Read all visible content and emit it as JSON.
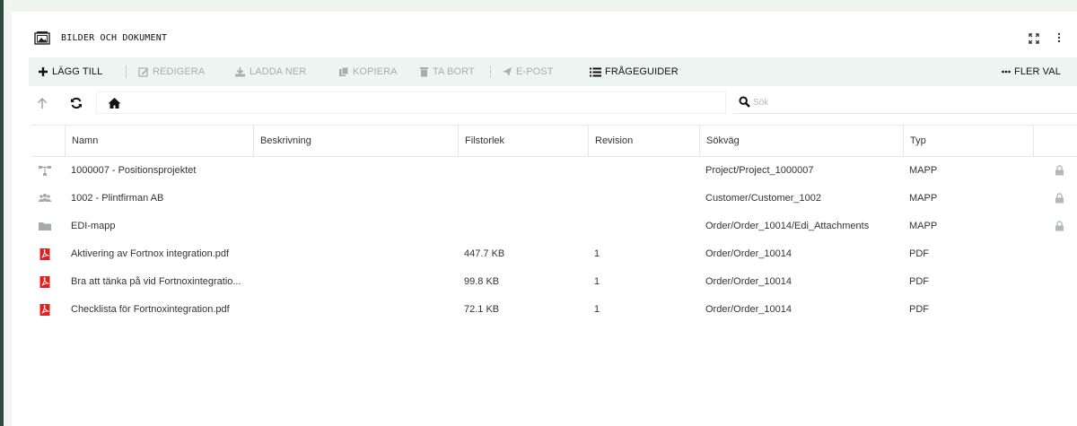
{
  "panel": {
    "title": "BILDER OCH DOKUMENT"
  },
  "toolbar": {
    "add": "LÄGG TILL",
    "edit": "REDIGERA",
    "download": "LADDA NER",
    "copy": "KOPIERA",
    "delete": "TA BORT",
    "email": "E-POST",
    "query_guides": "FRÅGEGUIDER",
    "more": "FLER VAL"
  },
  "search": {
    "placeholder": "Sök"
  },
  "table": {
    "columns": [
      "Namn",
      "Beskrivning",
      "Filstorlek",
      "Revision",
      "Sökväg",
      "Typ"
    ],
    "rows": [
      {
        "icon": "project-tree-icon",
        "name": "1000007 - Positionsprojektet",
        "description": "",
        "size": "",
        "revision": "",
        "path": "Project/Project_1000007",
        "type": "MAPP",
        "locked": true
      },
      {
        "icon": "customer-group-icon",
        "name": "1002 - Plintfirman AB",
        "description": "",
        "size": "",
        "revision": "",
        "path": "Customer/Customer_1002",
        "type": "MAPP",
        "locked": true
      },
      {
        "icon": "folder-icon",
        "name": "EDI-mapp",
        "description": "",
        "size": "",
        "revision": "",
        "path": "Order/Order_10014/Edi_Attachments",
        "type": "MAPP",
        "locked": true
      },
      {
        "icon": "pdf-icon",
        "name": "Aktivering av Fortnox integration.pdf",
        "description": "",
        "size": "447.7 KB",
        "revision": "1",
        "path": "Order/Order_10014",
        "type": "PDF",
        "locked": false
      },
      {
        "icon": "pdf-icon",
        "name": "Bra att tänka på vid Fortnoxintegratio...",
        "description": "",
        "size": "99.8 KB",
        "revision": "1",
        "path": "Order/Order_10014",
        "type": "PDF",
        "locked": false
      },
      {
        "icon": "pdf-icon",
        "name": "Checklista för Fortnoxintegration.pdf",
        "description": "",
        "size": "72.1 KB",
        "revision": "1",
        "path": "Order/Order_10014",
        "type": "PDF",
        "locked": false
      }
    ]
  },
  "colors": {
    "pdf": "#e02020",
    "folder_gray": "#a5aaa8",
    "toolbar_bg": "#eef4f1",
    "left_accent": "#2f4a3e"
  }
}
